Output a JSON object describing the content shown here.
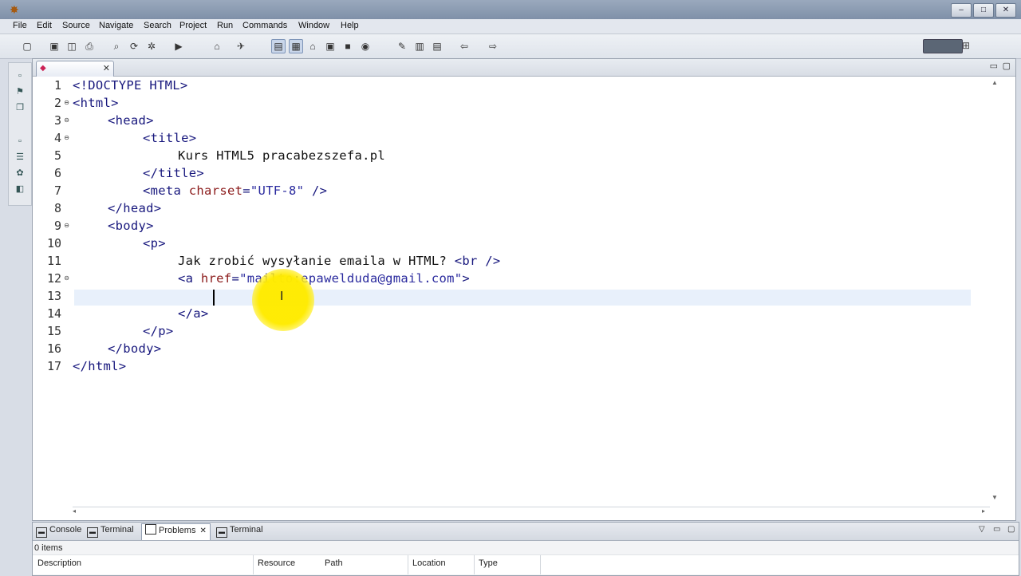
{
  "window": {
    "title": "",
    "controls": [
      "–",
      "□",
      "✕"
    ]
  },
  "menubar": {
    "items": [
      "File",
      "Edit",
      "Source",
      "Navigate",
      "Search",
      "Project",
      "Run",
      "Commands",
      "Window",
      "Help"
    ]
  },
  "editor": {
    "tab": {
      "label": "",
      "close": "✕"
    },
    "line_numbers": [
      "1",
      "2",
      "3",
      "4",
      "5",
      "6",
      "7",
      "8",
      "9",
      "10",
      "11",
      "12",
      "13",
      "14",
      "15",
      "16",
      "17"
    ],
    "fold_markers": [
      "⊖",
      "⊖",
      "⊖",
      "⊖",
      "⊖"
    ],
    "code": {
      "l1": "<!DOCTYPE HTML>",
      "l2": "<html>",
      "l3": "<head>",
      "l4": "<title>",
      "l5": "Kurs HTML5 pracabezszefa.pl",
      "l6": "</title>",
      "l7_open": "<meta ",
      "l7_attr": "charset",
      "l7_eq": "=",
      "l7_val": "\"UTF-8\"",
      "l7_close": " />",
      "l8": "</head>",
      "l9": "<body>",
      "l10": "<p>",
      "l11_text": "Jak zrobić wysyłanie emaila w HTML? ",
      "l11_tag": "<br />",
      "l12_open": "<a ",
      "l12_attr": "href",
      "l12_eq": "=",
      "l12_val": "\"mailto:epawelduda@gmail.com\"",
      "l12_close": ">",
      "l14": "</a>",
      "l15": "</p>",
      "l16": "</body>",
      "l17": "</html>"
    }
  },
  "bottom_panel": {
    "tabs": [
      "Console",
      "Terminal",
      "Problems",
      "Terminal"
    ],
    "active_tab": "Problems",
    "items_count": "0 items",
    "columns": [
      "Description",
      "Resource",
      "Path",
      "Location",
      "Type"
    ]
  },
  "colors": {
    "tag": "#17177d",
    "attribute": "#8b1a1a",
    "string": "#2a2a9e",
    "current_line": "#e8f0fb",
    "cursor_highlight": "#ffeb00"
  }
}
